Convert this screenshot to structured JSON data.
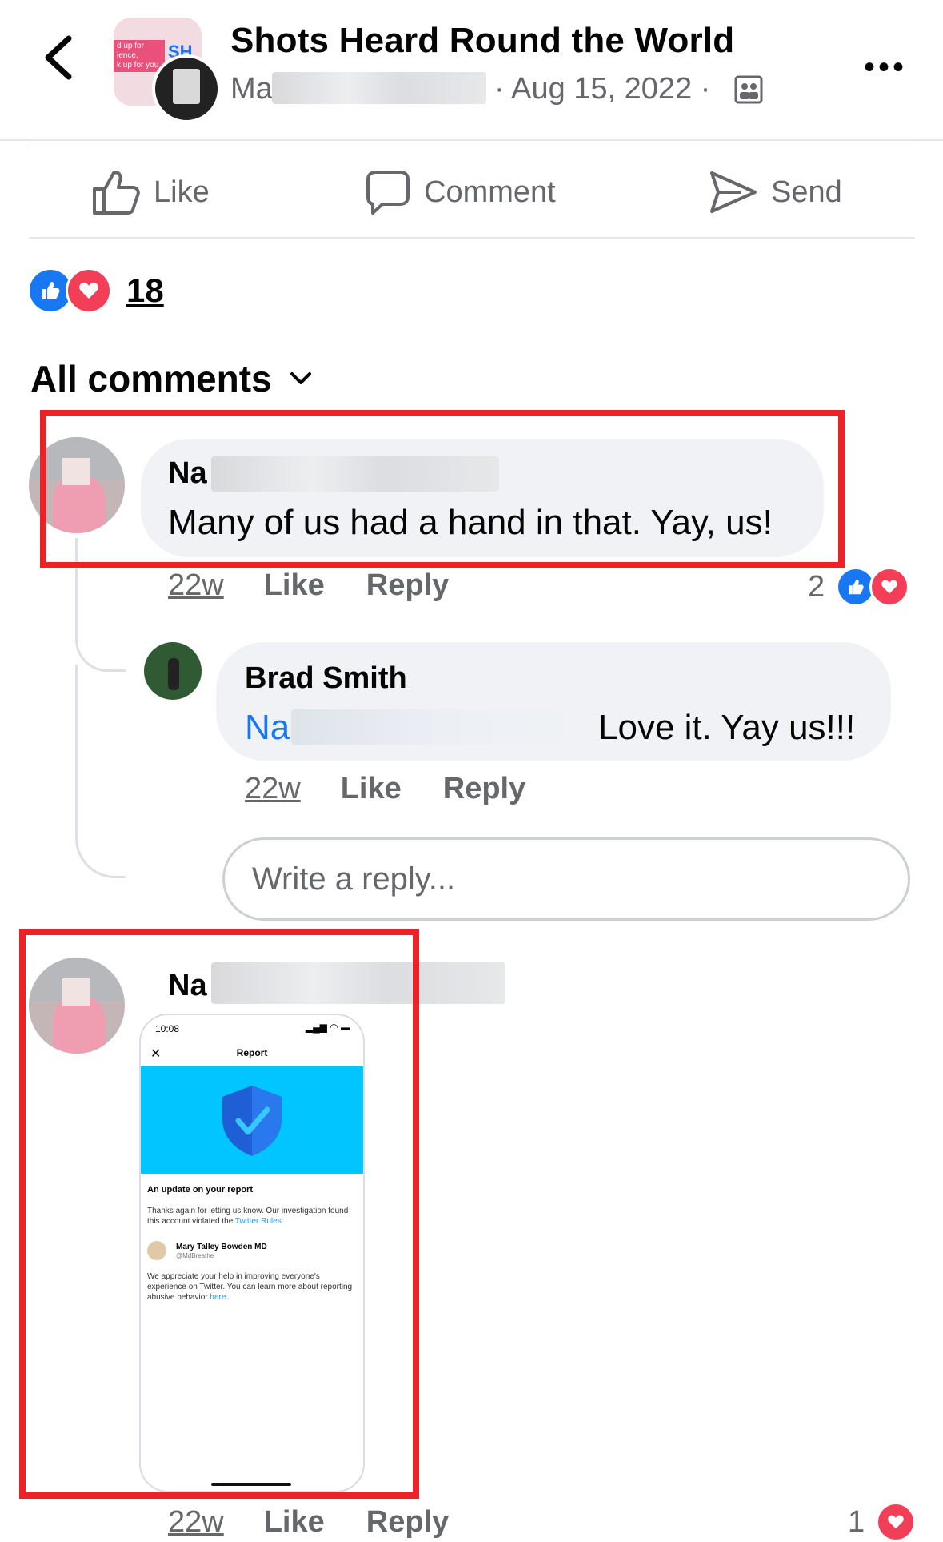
{
  "header": {
    "title": "Shots Heard Round the World",
    "author_visible": "Ma",
    "date_text": "· Aug 15, 2022 ·",
    "group_avatar_text": "d up for\nience,\nk up for you",
    "group_avatar_letters": "SH"
  },
  "actions": {
    "like": "Like",
    "comment": "Comment",
    "send": "Send"
  },
  "reactions": {
    "count": "18"
  },
  "comments_filter": {
    "label": "All comments"
  },
  "comments": [
    {
      "name_visible": "Na",
      "text": "Many of us had a hand in that. Yay, us!",
      "time": "22w",
      "like": "Like",
      "reply": "Reply",
      "reaction_count": "2"
    },
    {
      "name": "Brad Smith",
      "mention_visible": "Na",
      "text": "Love it. Yay us!!!",
      "time": "22w",
      "like": "Like",
      "reply": "Reply"
    }
  ],
  "reply_input": {
    "placeholder": "Write a reply..."
  },
  "comment3": {
    "name_visible": "Na",
    "time": "22w",
    "like": "Like",
    "reply": "Reply",
    "reaction_count": "1",
    "attachment": {
      "time": "10:08",
      "title": "Report",
      "heading": "An update on your report",
      "p1": "Thanks again for letting us know. Our investigation found this account violated the",
      "p1_link": "Twitter Rules:",
      "user_name": "Mary Talley Bowden MD",
      "user_handle": "@MdBreathe",
      "p2": "We appreciate your help in improving everyone's experience on Twitter. You can learn more about reporting abusive behavior",
      "p2_link": "here."
    }
  },
  "colors": {
    "accent": "#1877f2",
    "love": "#f33e58",
    "highlight": "#ec2227",
    "muted": "#65676b"
  }
}
